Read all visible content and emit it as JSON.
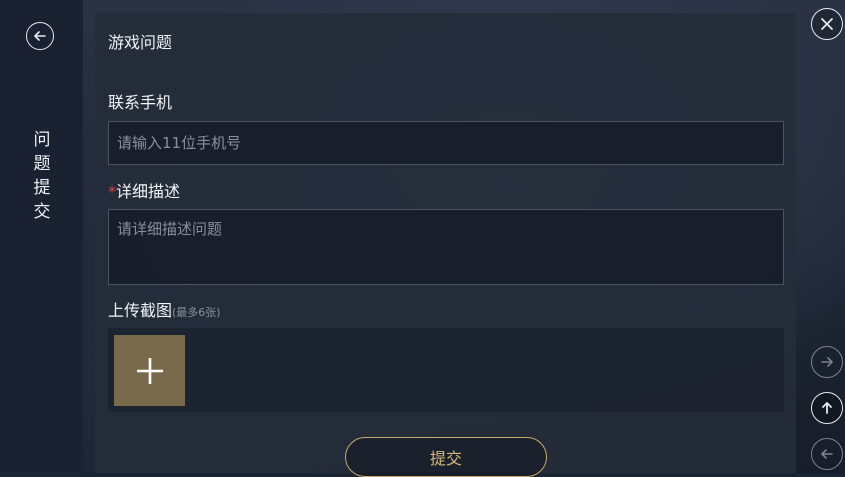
{
  "sidebar": {
    "title_chars": [
      "问",
      "题",
      "提",
      "交"
    ]
  },
  "form": {
    "category_title": "游戏问题",
    "phone_label": "联系手机",
    "phone_placeholder": "请输入11位手机号",
    "required_mark": "*",
    "desc_label": "详细描述",
    "desc_placeholder": "请详细描述问题",
    "upload_label": "上传截图",
    "upload_hint": "(最多6张)",
    "submit_label": "提交"
  },
  "icons": {
    "back": "back-arrow-icon",
    "close": "close-icon",
    "forward": "arrow-right-icon",
    "up": "arrow-up-icon",
    "left": "arrow-left-icon",
    "add": "plus-icon"
  },
  "colors": {
    "accent_gold": "#d8b777",
    "add_tile": "#7a6a4c",
    "required": "#e0413a"
  }
}
